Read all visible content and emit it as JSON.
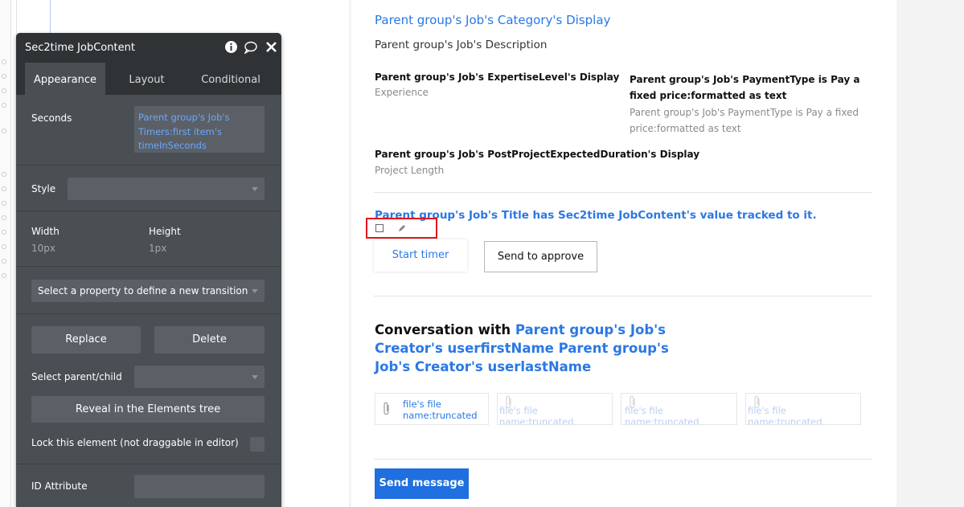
{
  "panel": {
    "title": "Sec2time JobContent",
    "tabs": [
      "Appearance",
      "Layout",
      "Conditional"
    ],
    "seconds_label": "Seconds",
    "seconds_value": "Parent group's Job's Timers:first item's timeInSeconds",
    "style_label": "Style",
    "width_label": "Width",
    "width_value": "10px",
    "height_label": "Height",
    "height_value": "1px",
    "transition_placeholder": "Select a property to define a new transition",
    "replace_label": "Replace",
    "delete_label": "Delete",
    "select_parent_label": "Select parent/child",
    "reveal_label": "Reveal in the Elements tree",
    "lock_label": "Lock this element (not draggable in editor)",
    "id_attribute_label": "ID Attribute"
  },
  "page": {
    "category": "Parent group's Job's Category's Display",
    "description": "Parent group's Job's Description",
    "expertise_value": "Parent group's Job's ExpertiseLevel's Display",
    "expertise_label": "Experience",
    "payment_value": "Parent group's Job's PaymentType is Pay a fixed price:formatted as text",
    "payment_label": "Parent group's Job's PaymentType is Pay a fixed price:formatted as text",
    "duration_value": "Parent group's Job's PostProjectExpectedDuration's Display",
    "duration_label": "Project Length",
    "tracked_title": "Parent group's Job's Title has Sec2time JobContent's value tracked to it.",
    "start_timer": "Start timer",
    "send_to_approve": "Send to approve",
    "conversation_prefix": "Conversation with ",
    "conversation_name": "Parent group's Job's Creator's userfirstName Parent group's Job's Creator's userlastName",
    "files": [
      "file's file name:truncated",
      "file's file name:truncated",
      "file's file name:truncated",
      "file's file name:truncated"
    ],
    "send_message": "Send message"
  },
  "colors": {
    "accent_blue": "#2a78e4",
    "panel_bg": "#4a4f54",
    "panel_header": "#2f3336",
    "selection_red": "#e3161f",
    "send_button": "#1f6fe0"
  }
}
